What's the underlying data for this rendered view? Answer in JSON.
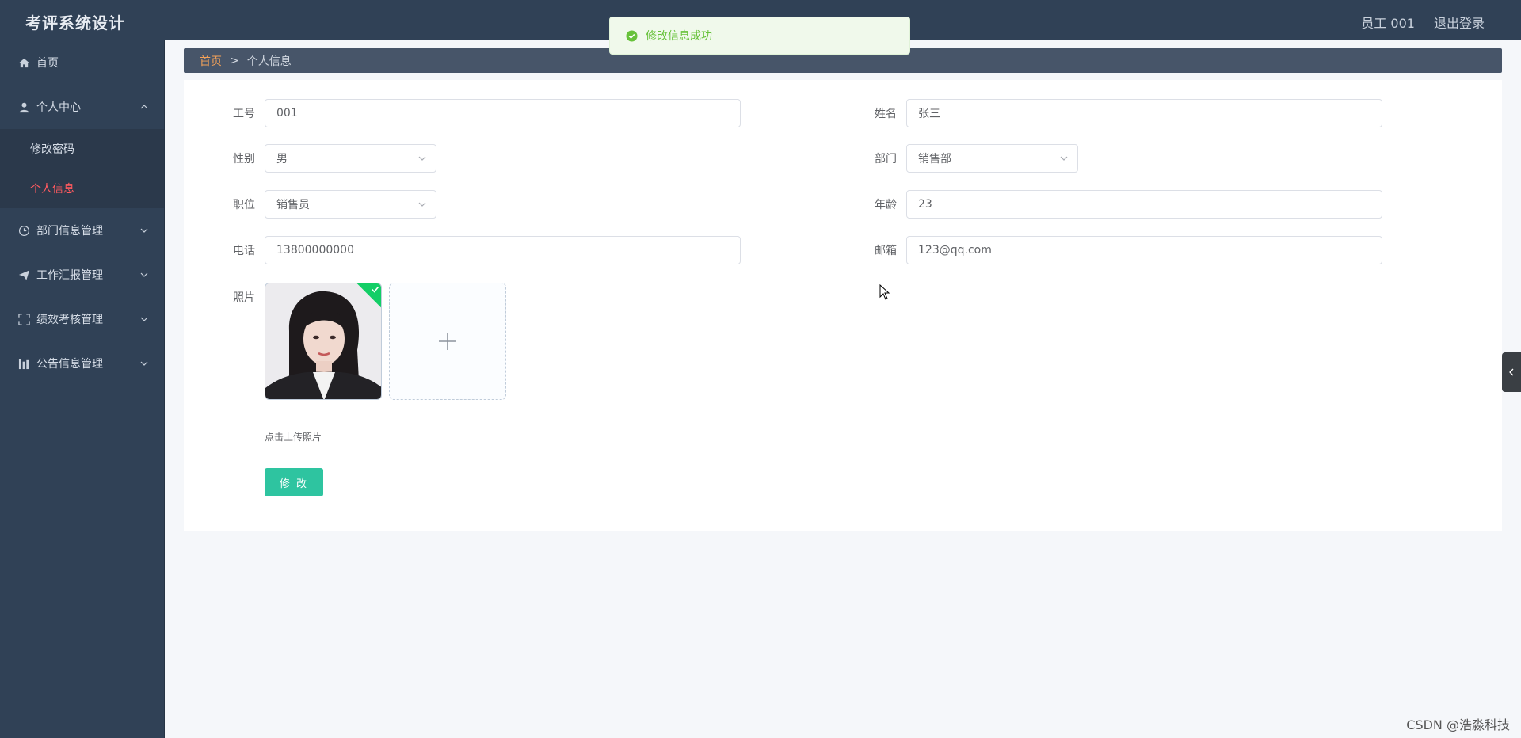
{
  "header": {
    "title": "考评系统设计",
    "user": "员工 001",
    "logout": "退出登录"
  },
  "sidebar": {
    "items": [
      {
        "label": "首页"
      },
      {
        "label": "个人中心",
        "children": [
          {
            "label": "修改密码"
          },
          {
            "label": "个人信息"
          }
        ]
      },
      {
        "label": "部门信息管理"
      },
      {
        "label": "工作汇报管理"
      },
      {
        "label": "绩效考核管理"
      },
      {
        "label": "公告信息管理"
      }
    ]
  },
  "breadcrumb": {
    "home": "首页",
    "separator": ">",
    "current": "个人信息"
  },
  "form": {
    "job_no": {
      "label": "工号",
      "value": "001"
    },
    "name": {
      "label": "姓名",
      "value": "张三"
    },
    "gender": {
      "label": "性别",
      "value": "男"
    },
    "department": {
      "label": "部门",
      "value": "销售部"
    },
    "position": {
      "label": "职位",
      "value": "销售员"
    },
    "age": {
      "label": "年龄",
      "value": "23"
    },
    "phone": {
      "label": "电话",
      "value": "13800000000"
    },
    "email": {
      "label": "邮箱",
      "value": "123@qq.com"
    },
    "photo": {
      "label": "照片",
      "hint": "点击上传照片"
    },
    "submit_label": "修 改"
  },
  "toast": {
    "message": "修改信息成功"
  },
  "watermark": "CSDN @浩淼科技",
  "colors": {
    "sidebar_bg": "#304156",
    "active_menu": "#ff5a5f",
    "breadcrumb_home": "#f4a259",
    "submit": "#2ec4a0",
    "success": "#67c23a"
  },
  "icons": [
    "home-icon",
    "user-icon",
    "clock-icon",
    "send-icon",
    "scan-icon",
    "chart-icon",
    "chevron-down-icon",
    "chevron-up-icon",
    "check-circle-icon",
    "plus-icon",
    "chevron-left-icon"
  ]
}
